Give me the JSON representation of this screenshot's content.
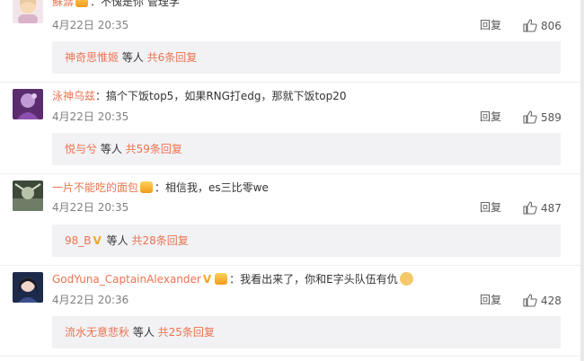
{
  "comments": [
    {
      "username": "蘇潺",
      "text": "：不愧是你 管理学",
      "date": "4月22日 20:35",
      "reply_label": "回复",
      "likes": "806",
      "replies": {
        "first_user": "神奇思惟姬",
        "joiner": " 等人 ",
        "count": "共6条回复"
      }
    },
    {
      "username": "泳神乌兹",
      "text": "：搞个下饭top5，如果RNG打edg，那就下饭top20",
      "date": "4月22日 20:35",
      "reply_label": "回复",
      "likes": "589",
      "replies": {
        "first_user": "悦与兮",
        "joiner": " 等人 ",
        "count": "共59条回复"
      }
    },
    {
      "username": "一片不能吃的面包",
      "text": "：相信我，es三比零we",
      "date": "4月22日 20:35",
      "reply_label": "回复",
      "likes": "487",
      "replies": {
        "first_user": "98_B",
        "joiner": " 等人 ",
        "count": "共28条回复"
      }
    },
    {
      "username": "GodYuna_CaptainAlexander",
      "text": "：我看出来了，你和E字头队伍有仇",
      "date": "4月22日 20:36",
      "reply_label": "回复",
      "likes": "428",
      "replies": {
        "first_user": "流水无意悲秋",
        "joiner": " 等人 ",
        "count": "共25条回复"
      }
    }
  ],
  "icons": {
    "like": "thumbs-up-icon",
    "vip": "vip-badge-icon",
    "verified": "verified-v-icon",
    "emoji": "doge-emoji-icon"
  },
  "colors": {
    "username": "#eb7350",
    "meta": "#808080",
    "subpanel": "#f2f2f5",
    "vip_badge": "#f5a623"
  }
}
